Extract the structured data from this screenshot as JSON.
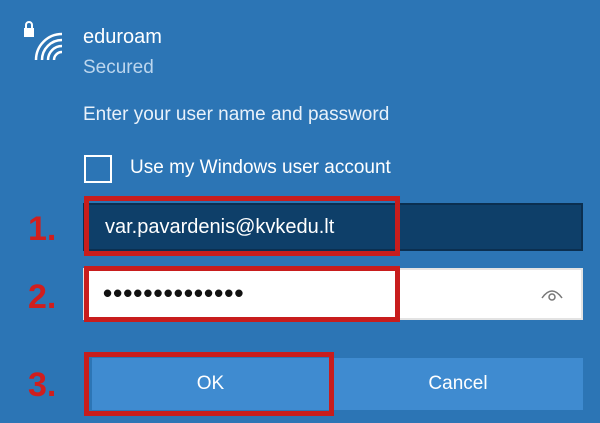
{
  "network": {
    "icon": "secured-wifi-icon",
    "name": "eduroam",
    "status": "Secured"
  },
  "prompt": "Enter your user name and password",
  "use_windows_account": {
    "label": "Use my Windows user account",
    "checked": false
  },
  "username": {
    "value": "var.pavardenis@kvkedu.lt"
  },
  "password": {
    "masked_value": "••••••••••••••",
    "reveal_icon": "eye-icon"
  },
  "buttons": {
    "ok": "OK",
    "cancel": "Cancel"
  },
  "annotations": {
    "step1": "1.",
    "step2": "2.",
    "step3": "3.",
    "color": "#c81d1d"
  }
}
